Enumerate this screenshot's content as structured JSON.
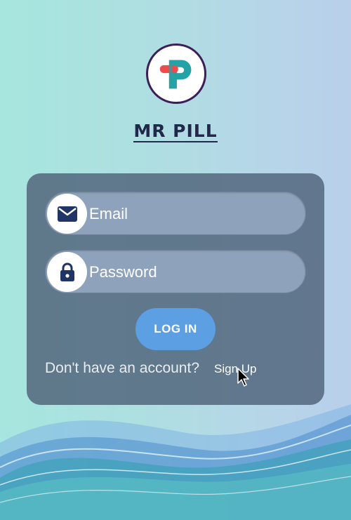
{
  "app": {
    "brand_name": "MR PILL",
    "logo_icon": "pill-p-logo-icon"
  },
  "login_form": {
    "email_placeholder": "Email",
    "password_placeholder": "Password",
    "email_icon": "envelope-icon",
    "password_icon": "lock-icon",
    "login_label": "LOG IN",
    "no_account_text": "Don't have an account?",
    "signup_label": "Sign Up"
  },
  "colors": {
    "brand_text": "#21294a",
    "card_bg": "#52667c",
    "login_button": "#5c9fe2",
    "logo_teal": "#25a2a6",
    "logo_red": "#ee4c4c",
    "logo_border": "#3b1f57"
  }
}
